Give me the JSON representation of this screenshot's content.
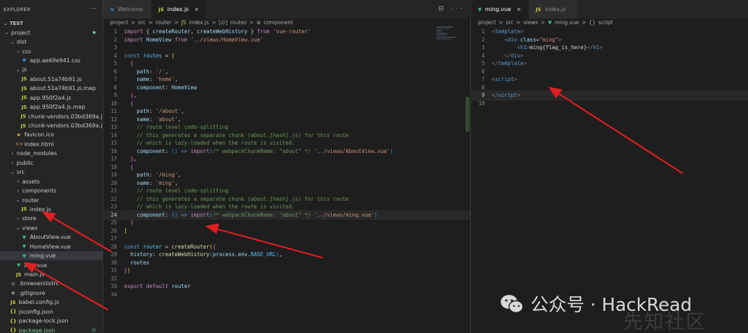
{
  "sidebar": {
    "title": "EXPLORER",
    "section": "TEST",
    "items": [
      {
        "label": "project",
        "chevron": "down",
        "indent": 0,
        "badge": "dot",
        "kind": "folder"
      },
      {
        "label": "dist",
        "chevron": "down",
        "indent": 1,
        "kind": "folder"
      },
      {
        "label": "css",
        "chevron": "down",
        "indent": 2,
        "kind": "folder"
      },
      {
        "label": "app.ae69e941.css",
        "indent": 3,
        "icon": "#",
        "kind": "css"
      },
      {
        "label": "js",
        "chevron": "down",
        "indent": 2,
        "kind": "folder"
      },
      {
        "label": "about.51a74b91.js",
        "indent": 3,
        "icon": "JS",
        "kind": "js"
      },
      {
        "label": "about.51a74b91.js.map",
        "indent": 3,
        "icon": "JS",
        "kind": "js"
      },
      {
        "label": "app.950f2a4.js",
        "indent": 3,
        "icon": "JS",
        "kind": "js"
      },
      {
        "label": "app.950f2a4.js.map",
        "indent": 3,
        "icon": "JS",
        "kind": "js"
      },
      {
        "label": "chunk-vendors.03bd369a.js",
        "indent": 3,
        "icon": "JS",
        "kind": "js"
      },
      {
        "label": "chunk-vendors.03bd369a.js.map",
        "indent": 3,
        "icon": "JS",
        "kind": "js"
      },
      {
        "label": "favicon.ico",
        "indent": 2,
        "icon": "★",
        "kind": "star"
      },
      {
        "label": "index.html",
        "indent": 2,
        "icon": "<>",
        "kind": "html"
      },
      {
        "label": "node_modules",
        "chevron": "right",
        "indent": 1,
        "kind": "folder"
      },
      {
        "label": "public",
        "chevron": "right",
        "indent": 1,
        "kind": "folder"
      },
      {
        "label": "src",
        "chevron": "down",
        "indent": 1,
        "kind": "folder"
      },
      {
        "label": "assets",
        "chevron": "right",
        "indent": 2,
        "kind": "folder"
      },
      {
        "label": "components",
        "chevron": "right",
        "indent": 2,
        "kind": "folder"
      },
      {
        "label": "router",
        "chevron": "down",
        "indent": 2,
        "kind": "folder"
      },
      {
        "label": "index.js",
        "indent": 3,
        "icon": "JS",
        "kind": "js"
      },
      {
        "label": "store",
        "chevron": "right",
        "indent": 2,
        "kind": "folder"
      },
      {
        "label": "views",
        "chevron": "down",
        "indent": 2,
        "kind": "folder"
      },
      {
        "label": "AboutView.vue",
        "indent": 3,
        "icon": "▼",
        "kind": "vue"
      },
      {
        "label": "HomeView.vue",
        "indent": 3,
        "icon": "▼",
        "kind": "vue"
      },
      {
        "label": "ming.vue",
        "indent": 3,
        "icon": "▼",
        "kind": "vue",
        "selected": true
      },
      {
        "label": "App.vue",
        "indent": 2,
        "icon": "▼",
        "kind": "vue"
      },
      {
        "label": "main.js",
        "indent": 2,
        "icon": "JS",
        "kind": "js"
      },
      {
        "label": ".browserslistrc",
        "indent": 1,
        "icon": "≡",
        "kind": "dot"
      },
      {
        "label": ".gitignore",
        "indent": 1,
        "icon": "◆",
        "kind": "dot"
      },
      {
        "label": "babel.config.js",
        "indent": 1,
        "icon": "JS",
        "kind": "js"
      },
      {
        "label": "jsconfig.json",
        "indent": 1,
        "icon": "{}",
        "kind": "json"
      },
      {
        "label": "package-lock.json",
        "indent": 1,
        "icon": "{}",
        "kind": "json"
      },
      {
        "label": "package.json",
        "indent": 1,
        "icon": "{}",
        "kind": "json",
        "badge": "U"
      }
    ]
  },
  "editor_left": {
    "tabs": [
      {
        "label": "Welcome",
        "icon": "≋",
        "active": false
      },
      {
        "label": "index.js",
        "icon": "JS",
        "active": true,
        "close": "×"
      }
    ],
    "breadcrumb": [
      "project",
      ">",
      "src",
      ">",
      "router",
      ">",
      "JS",
      "index.js",
      ">",
      "[∅]",
      "routes",
      ">",
      "⊛",
      "component"
    ],
    "current_line": 24,
    "lines": [
      [
        [
          "k",
          "import "
        ],
        [
          "p",
          "{ "
        ],
        [
          "v",
          "createRouter"
        ],
        [
          "p",
          ", "
        ],
        [
          "v",
          "createWebHistory"
        ],
        [
          "p",
          " } "
        ],
        [
          "k",
          "from "
        ],
        [
          "s",
          "'vue-router'"
        ]
      ],
      [
        [
          "k",
          "import "
        ],
        [
          "v",
          "HomeView "
        ],
        [
          "k",
          "from "
        ],
        [
          "s",
          "'../views/HomeView.vue'"
        ]
      ],
      [],
      [
        [
          "kb",
          "const "
        ],
        [
          "cst",
          "routes "
        ],
        [
          "p",
          "= "
        ],
        [
          "br1",
          "["
        ]
      ],
      [
        [
          "p",
          "  "
        ],
        [
          "br2",
          "{"
        ]
      ],
      [
        [
          "p",
          "    "
        ],
        [
          "v",
          "path"
        ],
        [
          "p",
          ": "
        ],
        [
          "s",
          "'/'"
        ],
        [
          "p",
          ","
        ]
      ],
      [
        [
          "p",
          "    "
        ],
        [
          "v",
          "name"
        ],
        [
          "p",
          ": "
        ],
        [
          "s",
          "'home'"
        ],
        [
          "p",
          ","
        ]
      ],
      [
        [
          "p",
          "    "
        ],
        [
          "v",
          "component"
        ],
        [
          "p",
          ": "
        ],
        [
          "v",
          "HomeView"
        ]
      ],
      [
        [
          "p",
          "  "
        ],
        [
          "br2",
          "}"
        ],
        [
          "p",
          ","
        ]
      ],
      [
        [
          "p",
          "  "
        ],
        [
          "br2",
          "{"
        ]
      ],
      [
        [
          "p",
          "    "
        ],
        [
          "v",
          "path"
        ],
        [
          "p",
          ": "
        ],
        [
          "s",
          "'/about'"
        ],
        [
          "p",
          ","
        ]
      ],
      [
        [
          "p",
          "    "
        ],
        [
          "v",
          "name"
        ],
        [
          "p",
          ": "
        ],
        [
          "s",
          "'about'"
        ],
        [
          "p",
          ","
        ]
      ],
      [
        [
          "p",
          "    "
        ],
        [
          "c",
          "// route level code-splitting"
        ]
      ],
      [
        [
          "p",
          "    "
        ],
        [
          "c",
          "// this generates a separate chunk (about.[hash].js) for this route"
        ]
      ],
      [
        [
          "p",
          "    "
        ],
        [
          "c",
          "// which is lazy-loaded when the route is visited."
        ]
      ],
      [
        [
          "p",
          "    "
        ],
        [
          "v",
          "component"
        ],
        [
          "p",
          ": "
        ],
        [
          "br3",
          "()"
        ],
        [
          "p",
          " "
        ],
        [
          "kb",
          "=>"
        ],
        [
          "p",
          " "
        ],
        [
          "k",
          "import"
        ],
        [
          "br3",
          "("
        ],
        [
          "c",
          "/* webpackChunkName: \"about\" */"
        ],
        [
          "p",
          " "
        ],
        [
          "s",
          "'../views/AboutView.vue'"
        ],
        [
          "br3",
          ")"
        ]
      ],
      [
        [
          "p",
          "  "
        ],
        [
          "br2",
          "}"
        ],
        [
          "p",
          ","
        ]
      ],
      [
        [
          "p",
          "  "
        ],
        [
          "br2",
          "{"
        ]
      ],
      [
        [
          "p",
          "    "
        ],
        [
          "v",
          "path"
        ],
        [
          "p",
          ": "
        ],
        [
          "s",
          "'/ming'"
        ],
        [
          "p",
          ","
        ]
      ],
      [
        [
          "p",
          "    "
        ],
        [
          "v",
          "name"
        ],
        [
          "p",
          ": "
        ],
        [
          "s",
          "'ming'"
        ],
        [
          "p",
          ","
        ]
      ],
      [
        [
          "p",
          "    "
        ],
        [
          "c",
          "// route level code-splitting"
        ]
      ],
      [
        [
          "p",
          "    "
        ],
        [
          "c",
          "// this generates a separate chunk (about.[hash].js) for this route"
        ]
      ],
      [
        [
          "p",
          "    "
        ],
        [
          "c",
          "// which is lazy-loaded when the route is visited."
        ]
      ],
      [
        [
          "p",
          "    "
        ],
        [
          "v",
          "component"
        ],
        [
          "p",
          ": "
        ],
        [
          "br3",
          "()"
        ],
        [
          "p",
          " "
        ],
        [
          "kb",
          "=>"
        ],
        [
          "p",
          " "
        ],
        [
          "k",
          "import"
        ],
        [
          "br3",
          "("
        ],
        [
          "c",
          "/* webpackChunkName: \"about\" */"
        ],
        [
          "p",
          " "
        ],
        [
          "s",
          "'../views/ming.vue'"
        ],
        [
          "br3",
          ")"
        ]
      ],
      [
        [
          "p",
          "  "
        ],
        [
          "br2",
          "}"
        ]
      ],
      [
        [
          "br1",
          "]"
        ]
      ],
      [],
      [
        [
          "kb",
          "const "
        ],
        [
          "cst",
          "router "
        ],
        [
          "p",
          "= "
        ],
        [
          "f",
          "createRouter"
        ],
        [
          "br1",
          "("
        ],
        [
          "br2",
          "{"
        ]
      ],
      [
        [
          "p",
          "  "
        ],
        [
          "v",
          "history"
        ],
        [
          "p",
          ": "
        ],
        [
          "f",
          "createWebHistory"
        ],
        [
          "br3",
          "("
        ],
        [
          "v",
          "process"
        ],
        [
          "p",
          "."
        ],
        [
          "v",
          "env"
        ],
        [
          "p",
          "."
        ],
        [
          "cst",
          "BASE_URL"
        ],
        [
          "br3",
          ")"
        ],
        [
          "p",
          ","
        ]
      ],
      [
        [
          "p",
          "  "
        ],
        [
          "v",
          "routes"
        ]
      ],
      [
        [
          "br2",
          "}"
        ],
        [
          "br1",
          ")"
        ]
      ],
      [],
      [
        [
          "k",
          "export "
        ],
        [
          "k",
          "default "
        ],
        [
          "v",
          "router"
        ]
      ],
      []
    ]
  },
  "editor_right": {
    "tabs": [
      {
        "label": "ming.vue",
        "icon": "▼",
        "active": true,
        "close": "×"
      },
      {
        "label": "index.js",
        "icon": "JS",
        "active": false
      }
    ],
    "breadcrumb": [
      "project",
      ">",
      "src",
      ">",
      "views",
      ">",
      "▼",
      "ming.vue",
      ">",
      "{}",
      "script"
    ],
    "current_line": 9,
    "lines": [
      [
        [
          "punct",
          "<"
        ],
        [
          "tag",
          "template"
        ],
        [
          "punct",
          ">"
        ]
      ],
      [
        [
          "p",
          "    "
        ],
        [
          "punct",
          "<"
        ],
        [
          "tag",
          "div "
        ],
        [
          "attr",
          "class"
        ],
        [
          "p",
          "="
        ],
        [
          "s",
          "\"ming\""
        ],
        [
          "punct",
          ">"
        ]
      ],
      [
        [
          "p",
          "        "
        ],
        [
          "punct",
          "<"
        ],
        [
          "tag",
          "h1"
        ],
        [
          "punct",
          ">"
        ],
        [
          "p",
          "ming{flag_is_here}"
        ],
        [
          "punct",
          "</"
        ],
        [
          "tag",
          "h1"
        ],
        [
          "punct",
          ">"
        ]
      ],
      [
        [
          "p",
          "    "
        ],
        [
          "punct",
          "</"
        ],
        [
          "tag",
          "div"
        ],
        [
          "punct",
          ">"
        ]
      ],
      [
        [
          "punct",
          "</"
        ],
        [
          "tag",
          "template"
        ],
        [
          "punct",
          ">"
        ]
      ],
      [],
      [
        [
          "punct",
          "<"
        ],
        [
          "tag",
          "script"
        ],
        [
          "punct",
          ">"
        ]
      ],
      [],
      [
        [
          "punct",
          "</"
        ],
        [
          "tag",
          "script"
        ],
        [
          "punct",
          ">"
        ]
      ],
      []
    ]
  },
  "watermark": {
    "text": "公众号 · HackRead",
    "secondary": "先知社区"
  },
  "colors": {
    "arrow": "#e02020",
    "vue": "#41b883",
    "js": "#cbcb41",
    "accent": "#007acc"
  }
}
